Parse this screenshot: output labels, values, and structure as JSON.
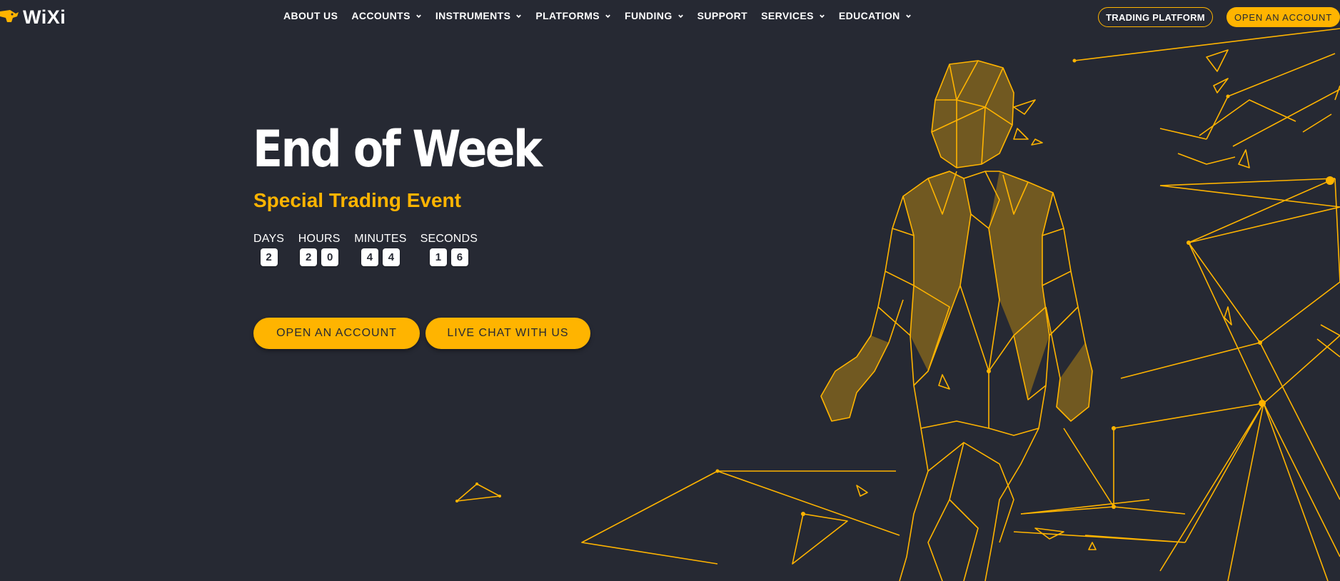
{
  "brand": {
    "name": "WiXi",
    "accent": "#ffb400",
    "background": "#262933"
  },
  "nav": {
    "items": [
      {
        "label": "ABOUT US",
        "dropdown": false
      },
      {
        "label": "ACCOUNTS",
        "dropdown": true
      },
      {
        "label": "INSTRUMENTS",
        "dropdown": true
      },
      {
        "label": "PLATFORMS",
        "dropdown": true
      },
      {
        "label": "FUNDING",
        "dropdown": true
      },
      {
        "label": "SUPPORT",
        "dropdown": false
      },
      {
        "label": "SERVICES",
        "dropdown": true
      },
      {
        "label": "EDUCATION",
        "dropdown": true
      }
    ]
  },
  "header_buttons": {
    "trading_platform": "TRADING PLATFORM",
    "open_account": "OPEN AN ACCOUNT"
  },
  "hero": {
    "title": "End of Week",
    "subtitle": "Special Trading Event",
    "countdown": {
      "days": {
        "label": "DAYS",
        "digits": [
          "2"
        ]
      },
      "hours": {
        "label": "HOURS",
        "digits": [
          "2",
          "0"
        ]
      },
      "minutes": {
        "label": "MINUTES",
        "digits": [
          "4",
          "4"
        ]
      },
      "seconds": {
        "label": "SECONDS",
        "digits": [
          "1",
          "6"
        ]
      }
    },
    "buttons": {
      "open_account": "OPEN AN ACCOUNT",
      "live_chat": "LIVE CHAT WITH US"
    }
  },
  "icons": {
    "logo": "bull-logo-icon",
    "dropdown": "chevron-down-icon",
    "artwork": "polygon-man-illustration"
  }
}
